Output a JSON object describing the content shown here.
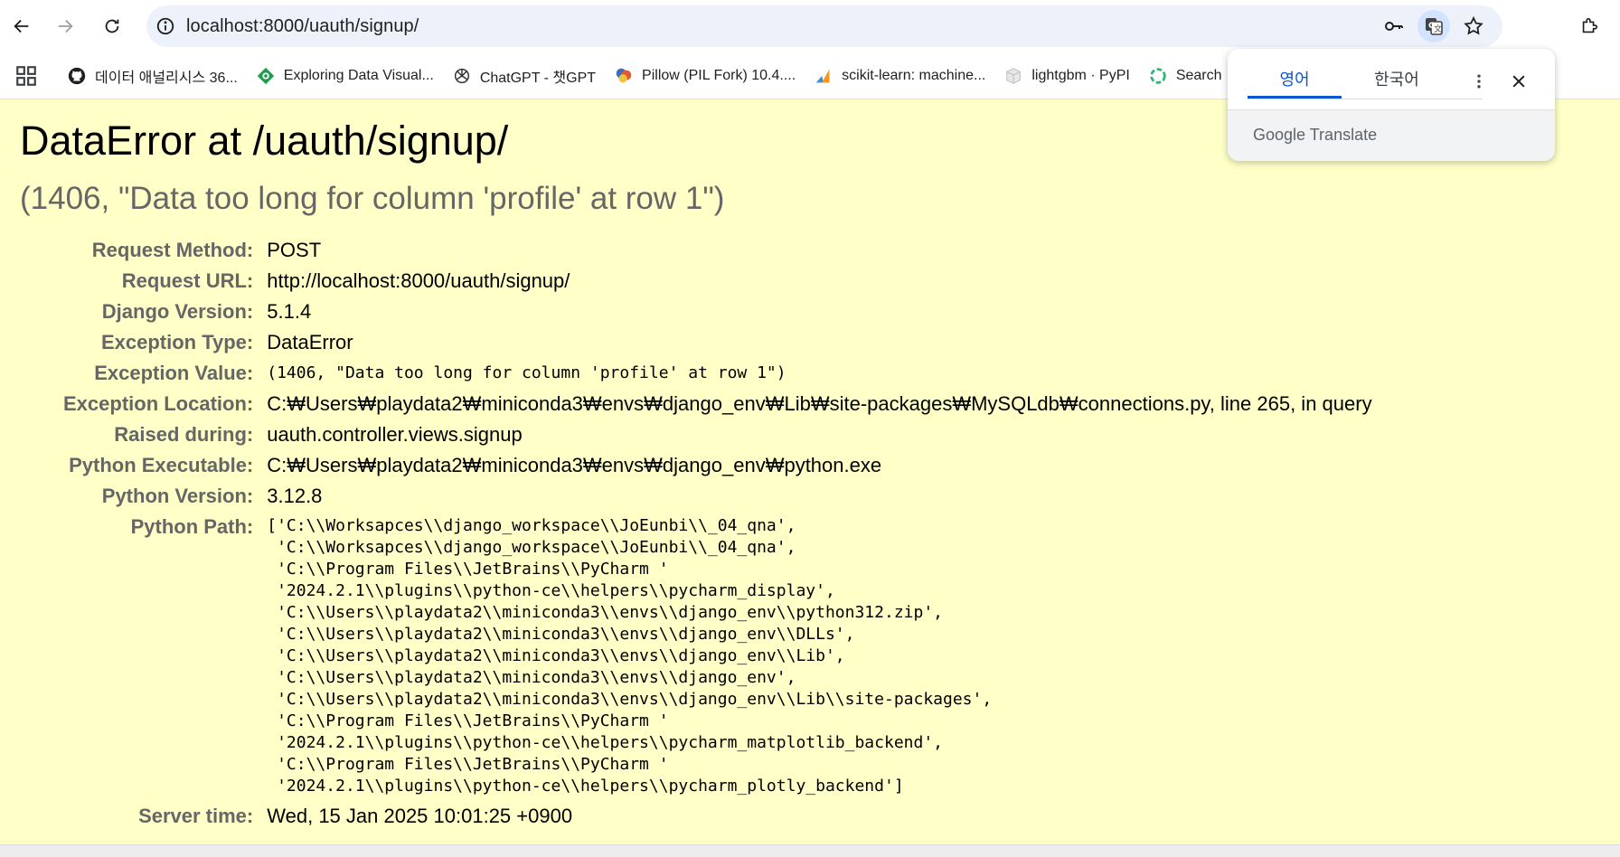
{
  "browser": {
    "url": "localhost:8000/uauth/signup/",
    "bookmarks": [
      {
        "label": "데이터 애널리시스 36...",
        "icon": "github-icon"
      },
      {
        "label": "Exploring Data Visual...",
        "icon": "data-visual-icon"
      },
      {
        "label": "ChatGPT - 챗GPT",
        "icon": "openai-icon"
      },
      {
        "label": "Pillow (PIL Fork) 10.4....",
        "icon": "pillow-icon"
      },
      {
        "label": "scikit-learn: machine...",
        "icon": "scikit-icon"
      },
      {
        "label": "lightgbm · PyPI",
        "icon": "pypi-icon"
      },
      {
        "label": "Search",
        "icon": "search-ring-icon"
      }
    ]
  },
  "translate_popup": {
    "tabs": [
      "영어",
      "한국어"
    ],
    "active_tab": 0,
    "brand_google": "Google",
    "brand_translate": "Translate"
  },
  "error": {
    "title": "DataError at /uauth/signup/",
    "subtitle": "(1406, \"Data too long for column 'profile' at row 1\")",
    "rows": {
      "request_method": {
        "label": "Request Method:",
        "value": "POST"
      },
      "request_url": {
        "label": "Request URL:",
        "value": "http://localhost:8000/uauth/signup/"
      },
      "django_version": {
        "label": "Django Version:",
        "value": "5.1.4"
      },
      "exception_type": {
        "label": "Exception Type:",
        "value": "DataError"
      },
      "exception_value": {
        "label": "Exception Value:",
        "value": "(1406, \"Data too long for column 'profile' at row 1\")"
      },
      "exception_location": {
        "label": "Exception Location:",
        "value": "C:₩Users₩playdata2₩miniconda3₩envs₩django_env₩Lib₩site-packages₩MySQLdb₩connections.py, line 265, in query"
      },
      "raised_during": {
        "label": "Raised during:",
        "value": "uauth.controller.views.signup"
      },
      "python_executable": {
        "label": "Python Executable:",
        "value": "C:₩Users₩playdata2₩miniconda3₩envs₩django_env₩python.exe"
      },
      "python_version": {
        "label": "Python Version:",
        "value": "3.12.8"
      },
      "python_path": {
        "label": "Python Path:",
        "value": "['C:\\\\Worksapces\\\\django_workspace\\\\JoEunbi\\\\_04_qna',\n 'C:\\\\Worksapces\\\\django_workspace\\\\JoEunbi\\\\_04_qna',\n 'C:\\\\Program Files\\\\JetBrains\\\\PyCharm '\n '2024.2.1\\\\plugins\\\\python-ce\\\\helpers\\\\pycharm_display',\n 'C:\\\\Users\\\\playdata2\\\\miniconda3\\\\envs\\\\django_env\\\\python312.zip',\n 'C:\\\\Users\\\\playdata2\\\\miniconda3\\\\envs\\\\django_env\\\\DLLs',\n 'C:\\\\Users\\\\playdata2\\\\miniconda3\\\\envs\\\\django_env\\\\Lib',\n 'C:\\\\Users\\\\playdata2\\\\miniconda3\\\\envs\\\\django_env',\n 'C:\\\\Users\\\\playdata2\\\\miniconda3\\\\envs\\\\django_env\\\\Lib\\\\site-packages',\n 'C:\\\\Program Files\\\\JetBrains\\\\PyCharm '\n '2024.2.1\\\\plugins\\\\python-ce\\\\helpers\\\\pycharm_matplotlib_backend',\n 'C:\\\\Program Files\\\\JetBrains\\\\PyCharm '\n '2024.2.1\\\\plugins\\\\python-ce\\\\helpers\\\\pycharm_plotly_backend']"
      },
      "server_time": {
        "label": "Server time:",
        "value": "Wed, 15 Jan 2025 10:01:25 +0900"
      }
    }
  },
  "colors": {
    "page_background": "#ffffc8",
    "label": "#666666",
    "omnibox": "#edf2fa",
    "accent": "#0b57d0"
  }
}
